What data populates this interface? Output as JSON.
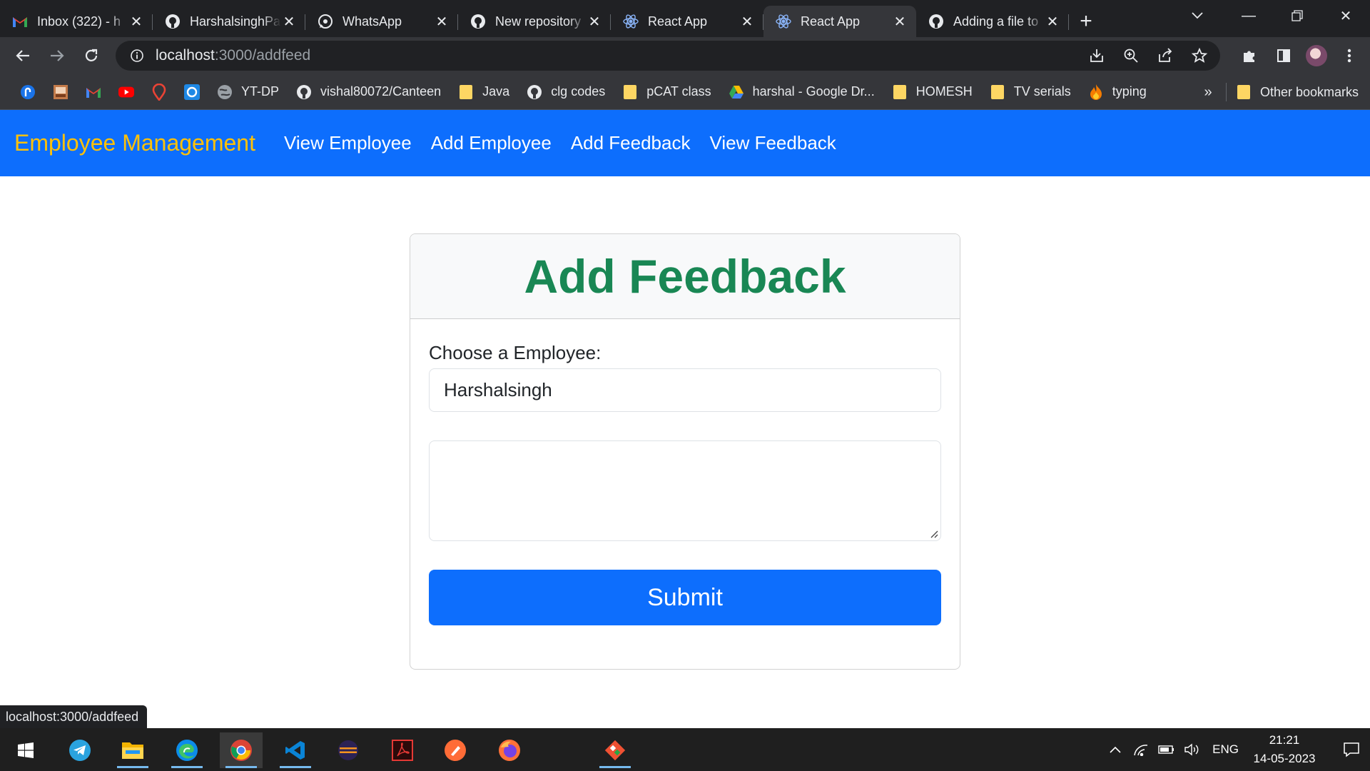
{
  "browser": {
    "tabs": [
      {
        "title": "Inbox (322) - h",
        "icon": "gmail-icon"
      },
      {
        "title": "HarshalsinghPa",
        "icon": "github-icon"
      },
      {
        "title": "WhatsApp",
        "icon": "whatsapp-icon"
      },
      {
        "title": "New repository",
        "icon": "github-icon"
      },
      {
        "title": "React App",
        "icon": "react-icon"
      },
      {
        "title": "React App",
        "icon": "react-icon",
        "active": true
      },
      {
        "title": "Adding a file to",
        "icon": "github-icon"
      }
    ],
    "address": {
      "host": "localhost",
      "path": ":3000/addfeed"
    },
    "bookmarks": [
      {
        "label": "",
        "icon": "bookmark-app-icon"
      },
      {
        "label": "",
        "icon": "bookmark-image-icon"
      },
      {
        "label": "",
        "icon": "gmail-icon"
      },
      {
        "label": "",
        "icon": "youtube-icon"
      },
      {
        "label": "",
        "icon": "maps-pin-icon"
      },
      {
        "label": "",
        "icon": "d-app-icon"
      },
      {
        "label": "YT-DP",
        "icon": "globe-icon"
      },
      {
        "label": "vishal80072/Canteen",
        "icon": "github-icon"
      },
      {
        "label": "Java",
        "icon": "folder-icon"
      },
      {
        "label": "clg codes",
        "icon": "github-icon"
      },
      {
        "label": "pCAT class",
        "icon": "folder-icon"
      },
      {
        "label": "harshal - Google Dr...",
        "icon": "google-drive-icon"
      },
      {
        "label": "HOMESH",
        "icon": "folder-icon"
      },
      {
        "label": "TV serials",
        "icon": "folder-icon"
      },
      {
        "label": "typing",
        "icon": "fire-icon"
      }
    ],
    "bookmarks_more": "»",
    "other_bookmarks": "Other bookmarks",
    "status_url": "localhost:3000/addfeed"
  },
  "app": {
    "brand": "Employee Management",
    "nav": [
      "View Employee",
      "Add Employee",
      "Add Feedback",
      "View Feedback"
    ],
    "card": {
      "title": "Add Feedback",
      "employee_label": "Choose a Employee:",
      "employee_selected": "Harshalsingh",
      "feedback_value": "",
      "submit_label": "Submit"
    }
  },
  "taskbar": {
    "apps": [
      "start-icon",
      "telegram-icon",
      "file-explorer-icon",
      "edge-icon",
      "chrome-icon",
      "vscode-icon",
      "eclipse-icon",
      "acrobat-icon",
      "postman-icon",
      "firefox-icon",
      "git-icon"
    ],
    "language": "ENG",
    "time": "21:21",
    "date": "14-05-2023"
  },
  "colors": {
    "navbar": "#0d6efd",
    "brand": "#ffc107",
    "title": "#198754",
    "button": "#0d6efd"
  }
}
